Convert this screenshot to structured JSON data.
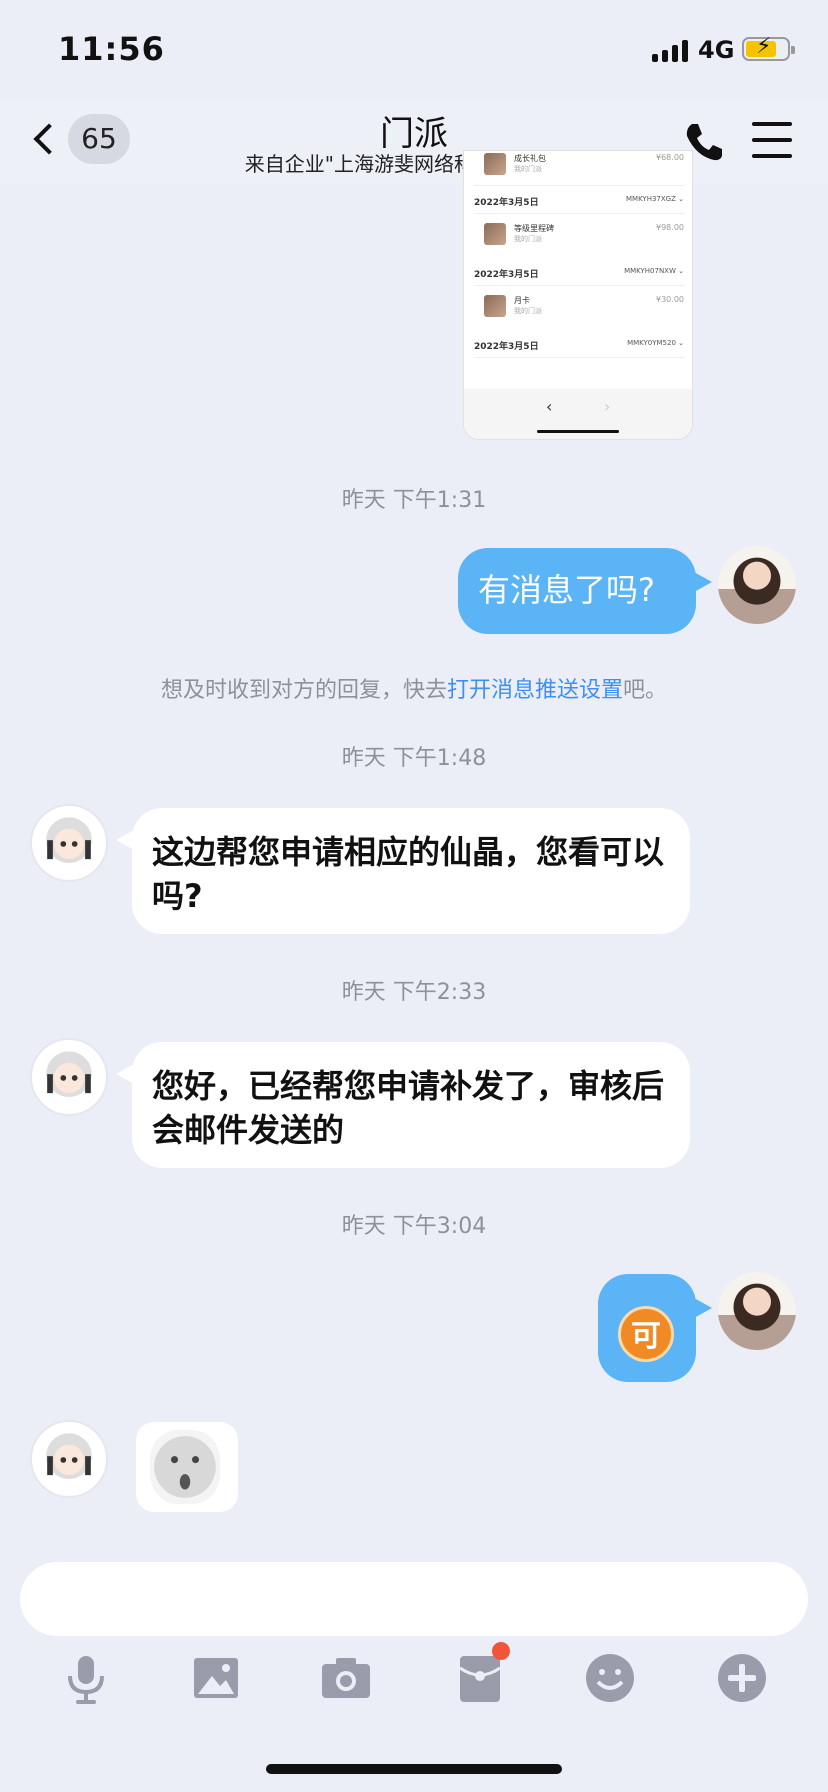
{
  "status_bar": {
    "time": "11:56",
    "network": "4G"
  },
  "header": {
    "unread_count": "65",
    "title": "门派",
    "subtitle": "来自企业\"上海游斐网络科技有限公司\""
  },
  "screenshot_card": {
    "rows": [
      {
        "name": "成长礼包",
        "sub": "我的门派",
        "price": "¥68.00"
      },
      {
        "date": "2022年3月5日",
        "code": "MMKYH37XGZ ⌄",
        "name": "等级里程碑",
        "sub": "我的门派",
        "price": "¥98.00"
      },
      {
        "date": "2022年3月5日",
        "code": "MMKYH07NXW ⌄",
        "name": "月卡",
        "sub": "我的门派",
        "price": "¥30.00"
      },
      {
        "date": "2022年3月5日",
        "code": "MMKY0YM520 ⌄"
      }
    ],
    "nav_prev": "‹",
    "nav_next": "›"
  },
  "messages": {
    "ts1": "昨天 下午1:31",
    "msg1": "有消息了吗?",
    "notice_prefix": "想及时收到对方的回复，快去",
    "notice_link": "打开消息推送设置",
    "notice_suffix": "吧。",
    "ts2": "昨天 下午1:48",
    "msg2": "这边帮您申请相应的仙晶，您看可以吗?",
    "ts3": "昨天 下午2:33",
    "msg3": "您好，已经帮您申请补发了，审核后会邮件发送的",
    "ts4": "昨天 下午3:04",
    "msg4_emoji": "可"
  },
  "input": {
    "placeholder": ""
  },
  "toolbar": {
    "icons": [
      "microphone-icon",
      "image-icon",
      "camera-icon",
      "red-packet-icon",
      "emoji-icon",
      "plus-icon"
    ],
    "icon_color": "#9a9cab",
    "badge_color": "#f0553a"
  },
  "colors": {
    "bubble_self": "#5ab4f6",
    "link": "#3b8ff5",
    "background": "#eceef7"
  }
}
